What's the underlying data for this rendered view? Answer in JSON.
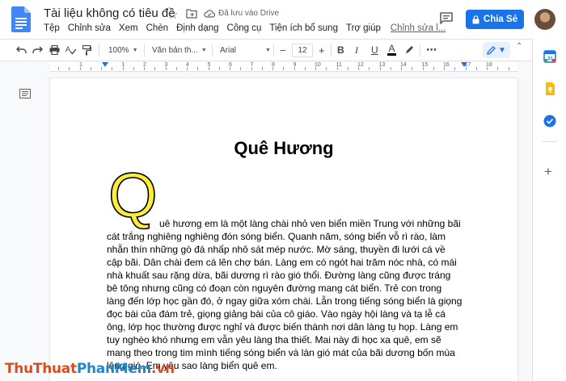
{
  "header": {
    "doc_title": "Tài liệu không có tiêu đề",
    "save_status": "Đã lưu vào Drive",
    "menu": [
      "Tệp",
      "Chỉnh sửa",
      "Xem",
      "Chèn",
      "Định dạng",
      "Công cụ",
      "Tiện ích bổ sung",
      "Trợ giúp"
    ],
    "last_edit": "Chỉnh sửa l...",
    "share_label": "Chia Sẻ"
  },
  "toolbar": {
    "zoom": "100%",
    "style": "Văn bản th...",
    "font": "Arial",
    "font_size": "12",
    "bold": "B",
    "italic": "I",
    "underline": "U",
    "text_color": "A",
    "more": "⋯",
    "collapse": "⌃"
  },
  "ruler": {
    "numbers": [
      "1",
      "1",
      "2",
      "3",
      "4",
      "5",
      "6",
      "7",
      "8",
      "9",
      "10",
      "11",
      "12",
      "13",
      "14",
      "15",
      "16",
      "17",
      "18"
    ]
  },
  "document": {
    "heading": "Quê Hương",
    "dropcap": "Q",
    "first_line": "uê hương em là một làng chài nhỏ ven biển miền Trung với những bãi",
    "body_rest": "cát trắng nghiêng nghiêng đón sóng biển. Quanh năm, sóng biển vỗ rì rào, làm nhẵn thín những gò đá nhấp nhô sát mép nước. Mờ sáng, thuyền đi lưới cá về cập bãi. Dân chài đem cá lên chợ bán. Làng em có ngót hai trăm nóc nhà, có mái nhà khuất sau rặng dừa, bãi dương rì rào gió thổi. Đường làng cũng được tráng bê tông nhưng cũng có đoạn còn nguyên đường mang cát biển. Trẻ con trong làng đến lớp học gần đó, ở ngay giữa xóm chài. Lẫn trong tiếng sóng biển là giọng đọc bài của đám trẻ, giọng giảng bài của cô giáo. Vào ngày hội làng và tạ lễ cá ông, lớp học thường được nghỉ và được biến thành nơi dân làng tụ họp. Làng em tuy nghèo khó nhưng em vẫn yêu làng tha thiết. Mai này đi học xa quê, em sẽ mang theo trong tim mình tiếng sóng biển và làn gió mát của bãi dương bốn mùa lộng gió. Em yêu sao làng biển quê em."
  },
  "watermark": {
    "part1": "ThuThuat",
    "part2": "PhanMem",
    "part3": ".vn"
  },
  "colors": {
    "accent": "#1a73e8",
    "dropcap_fill": "#ffeb3b"
  }
}
